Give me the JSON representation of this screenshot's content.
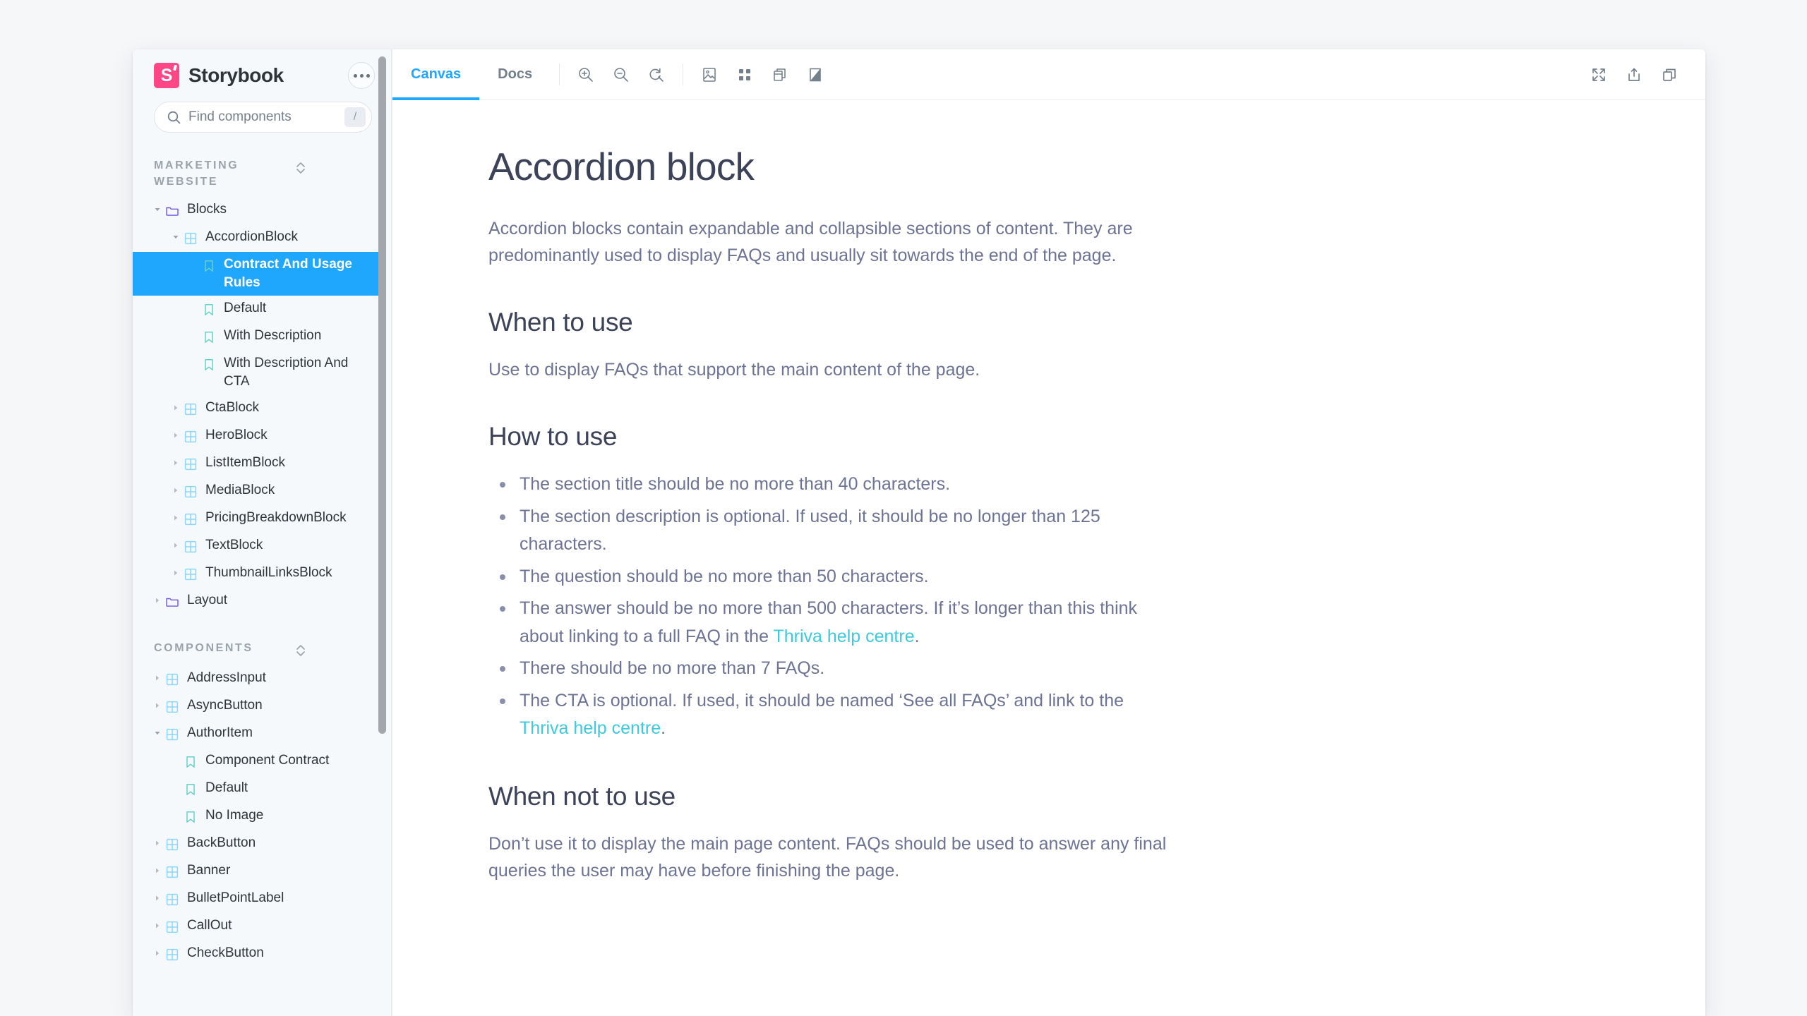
{
  "app": {
    "brand_name": "Storybook",
    "logo_letter": "S",
    "menu_button": "…"
  },
  "search": {
    "placeholder": "Find components",
    "shortcut": "/"
  },
  "sidebar": {
    "sections": [
      {
        "label": "MARKETING WEBSITE"
      },
      {
        "label": "COMPONENTS"
      }
    ],
    "tree": [
      {
        "label": "Blocks",
        "depth": 0,
        "icon": "folder-icon",
        "state": "expanded",
        "selected": false
      },
      {
        "label": "AccordionBlock",
        "depth": 1,
        "icon": "component-icon",
        "state": "expanded",
        "selected": false
      },
      {
        "label": "Contract And Usage Rules",
        "depth": 2,
        "icon": "story-icon",
        "state": "leaf",
        "selected": true
      },
      {
        "label": "Default",
        "depth": 2,
        "icon": "story-icon",
        "state": "leaf",
        "selected": false
      },
      {
        "label": "With Description",
        "depth": 2,
        "icon": "story-icon",
        "state": "leaf",
        "selected": false
      },
      {
        "label": "With Description And CTA",
        "depth": 2,
        "icon": "story-icon",
        "state": "leaf",
        "selected": false
      },
      {
        "label": "CtaBlock",
        "depth": 1,
        "icon": "component-icon",
        "state": "collapsed",
        "selected": false
      },
      {
        "label": "HeroBlock",
        "depth": 1,
        "icon": "component-icon",
        "state": "collapsed",
        "selected": false
      },
      {
        "label": "ListItemBlock",
        "depth": 1,
        "icon": "component-icon",
        "state": "collapsed",
        "selected": false
      },
      {
        "label": "MediaBlock",
        "depth": 1,
        "icon": "component-icon",
        "state": "collapsed",
        "selected": false
      },
      {
        "label": "PricingBreakdownBlock",
        "depth": 1,
        "icon": "component-icon",
        "state": "collapsed",
        "selected": false
      },
      {
        "label": "TextBlock",
        "depth": 1,
        "icon": "component-icon",
        "state": "collapsed",
        "selected": false
      },
      {
        "label": "ThumbnailLinksBlock",
        "depth": 1,
        "icon": "component-icon",
        "state": "collapsed",
        "selected": false
      },
      {
        "label": "Layout",
        "depth": 0,
        "icon": "folder-icon",
        "state": "collapsed",
        "selected": false
      }
    ],
    "tree2": [
      {
        "label": "AddressInput",
        "depth": 0,
        "icon": "component-icon",
        "state": "collapsed",
        "selected": false
      },
      {
        "label": "AsyncButton",
        "depth": 0,
        "icon": "component-icon",
        "state": "collapsed",
        "selected": false
      },
      {
        "label": "AuthorItem",
        "depth": 0,
        "icon": "component-icon",
        "state": "expanded",
        "selected": false
      },
      {
        "label": "Component Contract",
        "depth": 1,
        "icon": "story-icon",
        "state": "leaf",
        "selected": false
      },
      {
        "label": "Default",
        "depth": 1,
        "icon": "story-icon",
        "state": "leaf",
        "selected": false
      },
      {
        "label": "No Image",
        "depth": 1,
        "icon": "story-icon",
        "state": "leaf",
        "selected": false
      },
      {
        "label": "BackButton",
        "depth": 0,
        "icon": "component-icon",
        "state": "collapsed",
        "selected": false
      },
      {
        "label": "Banner",
        "depth": 0,
        "icon": "component-icon",
        "state": "collapsed",
        "selected": false
      },
      {
        "label": "BulletPointLabel",
        "depth": 0,
        "icon": "component-icon",
        "state": "collapsed",
        "selected": false
      },
      {
        "label": "CallOut",
        "depth": 0,
        "icon": "component-icon",
        "state": "collapsed",
        "selected": false
      },
      {
        "label": "CheckButton",
        "depth": 0,
        "icon": "component-icon",
        "state": "collapsed",
        "selected": false
      }
    ]
  },
  "toolbar": {
    "tabs": [
      {
        "label": "Canvas",
        "active": true
      },
      {
        "label": "Docs",
        "active": false
      }
    ],
    "left_tools": [
      "zoom-in-icon",
      "zoom-out-icon",
      "zoom-reset-icon"
    ],
    "addon_tools": [
      "background-icon",
      "grid-icon",
      "measure-icon",
      "outline-icon"
    ],
    "right_tools": [
      "fullscreen-icon",
      "open-in-new-tab-icon",
      "copy-link-icon"
    ]
  },
  "doc": {
    "title": "Accordion block",
    "intro": "Accordion blocks contain expandable and collapsible sections of content. They are predominantly used to display FAQs and usually sit towards the end of the page.",
    "when_to_use_heading": "When to use",
    "when_to_use_body": "Use to display FAQs that support the main content of the page.",
    "how_to_use_heading": "How to use",
    "rules": [
      {
        "pre": "The section title should be no more than 40 characters.",
        "link": "",
        "post": ""
      },
      {
        "pre": "The section description is optional. If used, it should be no longer than 125 characters.",
        "link": "",
        "post": ""
      },
      {
        "pre": "The question should be no more than 50 characters.",
        "link": "",
        "post": ""
      },
      {
        "pre": "The answer should be no more than 500 characters. If it’s longer than this think about linking to a full FAQ in the ",
        "link": "Thriva help centre",
        "post": "."
      },
      {
        "pre": "There should be no more than 7 FAQs.",
        "link": "",
        "post": ""
      },
      {
        "pre": "The CTA is optional. If used, it should be named ‘See all FAQs’ and link to the ",
        "link": "Thriva help centre",
        "post": "."
      }
    ],
    "when_not_to_use_heading": "When not to use",
    "when_not_to_use_body": "Don’t use it to display the main page content. FAQs should be used to answer any final queries the user may have before finishing the page."
  },
  "colors": {
    "brand_pink": "#ff4785",
    "accent_blue": "#1ea7fd",
    "link_teal": "#3fc9db",
    "sidebar_bg": "#f6f9fc",
    "page_bg": "#f6f7f9",
    "folder_purple": "#6f52ed",
    "component_blue": "#8bd6fb",
    "story_teal": "#66d0c8",
    "heading": "#3c4257",
    "body_text": "#6d7392"
  }
}
